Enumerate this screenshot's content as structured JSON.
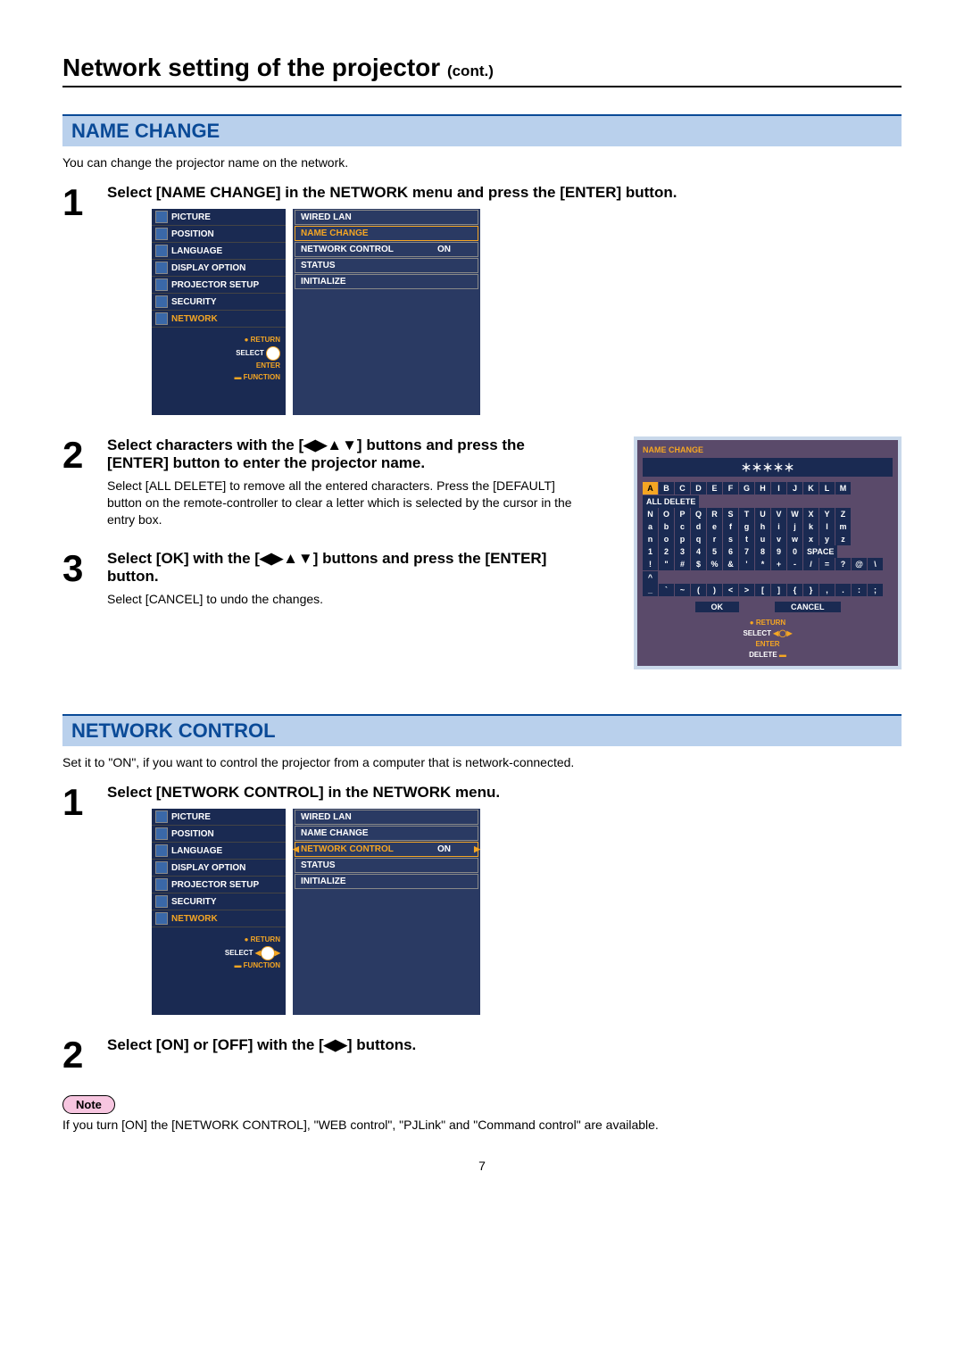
{
  "page_number": "7",
  "title_main": "Network setting of the projector",
  "title_cont": "(cont.)",
  "section1": {
    "header": "NAME CHANGE",
    "intro": "You can change the projector name on the network.",
    "step1": {
      "n": "1",
      "title": "Select [NAME CHANGE] in the NETWORK menu and press the [ENTER] button."
    },
    "step2": {
      "n": "2",
      "title": "Select characters with the [◀▶▲▼] buttons and press the [ENTER] button to enter the projector name.",
      "sub": "Select [ALL DELETE] to remove all the entered characters. Press the [DEFAULT] button on the remote-controller to clear a letter which is selected by the cursor in the entry box."
    },
    "step3": {
      "n": "3",
      "title": "Select [OK] with the [◀▶▲▼] buttons and press the [ENTER] button.",
      "sub": "Select [CANCEL] to undo the changes."
    }
  },
  "section2": {
    "header": "NETWORK CONTROL",
    "intro": "Set it to \"ON\", if you want to control the projector from a computer that is network-connected.",
    "step1": {
      "n": "1",
      "title": "Select [NETWORK CONTROL] in the NETWORK menu."
    },
    "step2": {
      "n": "2",
      "title": "Select [ON] or [OFF] with the [◀▶] buttons."
    }
  },
  "note": {
    "badge": "Note",
    "text": "If you turn [ON] the [NETWORK CONTROL], \"WEB control\", \"PJLink\" and \"Command control\" are available."
  },
  "menu": {
    "sidebar": [
      "PICTURE",
      "POSITION",
      "LANGUAGE",
      "DISPLAY OPTION",
      "PROJECTOR SETUP",
      "SECURITY",
      "NETWORK"
    ],
    "hints": {
      "return": "RETURN",
      "select": "SELECT",
      "enter": "ENTER",
      "function": "FUNCTION"
    },
    "panel1": {
      "items": [
        "WIRED LAN",
        "NAME CHANGE",
        "NETWORK CONTROL",
        "STATUS",
        "INITIALIZE"
      ],
      "on": "ON",
      "sel": 1
    },
    "panel2": {
      "items": [
        "WIRED LAN",
        "NAME CHANGE",
        "NETWORK CONTROL",
        "STATUS",
        "INITIALIZE"
      ],
      "on": "ON",
      "sel": 2
    }
  },
  "keyboard": {
    "title": "NAME CHANGE",
    "entry": "＊＊＊＊＊",
    "rows": [
      [
        "A",
        "B",
        "C",
        "D",
        "E",
        "F",
        "G",
        "H",
        "I",
        "J",
        "K",
        "L",
        "M"
      ],
      [
        "N",
        "O",
        "P",
        "Q",
        "R",
        "S",
        "T",
        "U",
        "V",
        "W",
        "X",
        "Y",
        "Z"
      ],
      [
        "a",
        "b",
        "c",
        "d",
        "e",
        "f",
        "g",
        "h",
        "i",
        "j",
        "k",
        "l",
        "m"
      ],
      [
        "n",
        "o",
        "p",
        "q",
        "r",
        "s",
        "t",
        "u",
        "v",
        "w",
        "x",
        "y",
        "z"
      ],
      [
        "1",
        "2",
        "3",
        "4",
        "5",
        "6",
        "7",
        "8",
        "9",
        "0"
      ],
      [
        "!",
        "\"",
        "#",
        "$",
        "%",
        "&",
        "'",
        "*",
        "+",
        "-",
        "/",
        "=",
        "?",
        "@",
        "\\",
        "^"
      ],
      [
        "_",
        "`",
        "~",
        "(",
        ")",
        "<",
        ">",
        "[",
        "]",
        "{",
        "}",
        ",",
        ".",
        ":",
        ";"
      ]
    ],
    "space": "SPACE",
    "all_delete": "ALL DELETE",
    "ok": "OK",
    "cancel": "CANCEL",
    "hints": {
      "return": "RETURN",
      "select": "SELECT",
      "enter": "ENTER",
      "delete": "DELETE"
    }
  }
}
